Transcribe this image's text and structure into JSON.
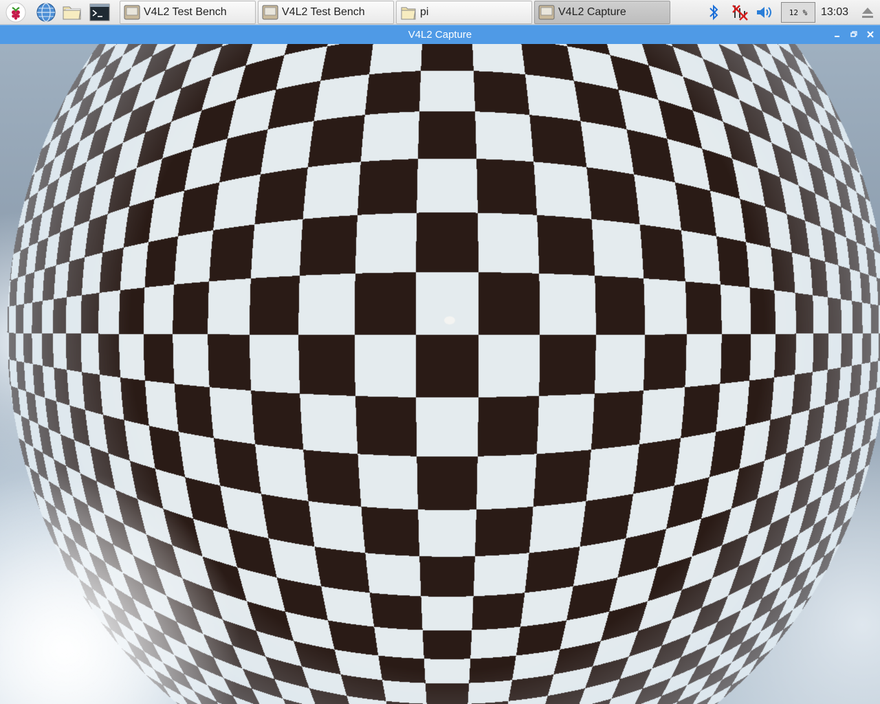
{
  "taskbar": {
    "launchers": [
      {
        "icon": "raspberry-menu-icon"
      },
      {
        "icon": "web-browser-icon"
      },
      {
        "icon": "file-manager-icon"
      },
      {
        "icon": "terminal-icon"
      }
    ],
    "tasks": [
      {
        "label": "V4L2 Test Bench",
        "icon": "app-window-icon",
        "active": false
      },
      {
        "label": "V4L2 Test Bench",
        "icon": "app-window-icon",
        "active": false
      },
      {
        "label": "pi",
        "icon": "folder-icon",
        "active": false
      },
      {
        "label": "V4L2 Capture",
        "icon": "app-window-icon",
        "active": true
      }
    ],
    "tray": {
      "bluetooth_icon": "bluetooth-icon",
      "network_icon": "network-disconnected-icon",
      "volume_icon": "volume-icon",
      "cpu_label": "12 %",
      "clock": "13:03",
      "eject_icon": "eject-icon"
    }
  },
  "window": {
    "title": "V4L2 Capture",
    "controls": [
      "minimize",
      "maximize",
      "close"
    ],
    "content": "fisheye camera frame of a black and white calibration checkerboard"
  },
  "colors": {
    "taskbar_bg": "#e8e8e8",
    "titlebar_bg": "#4f9ae6",
    "board_dark": "#2a1b16",
    "board_light": "#e6ecef"
  }
}
